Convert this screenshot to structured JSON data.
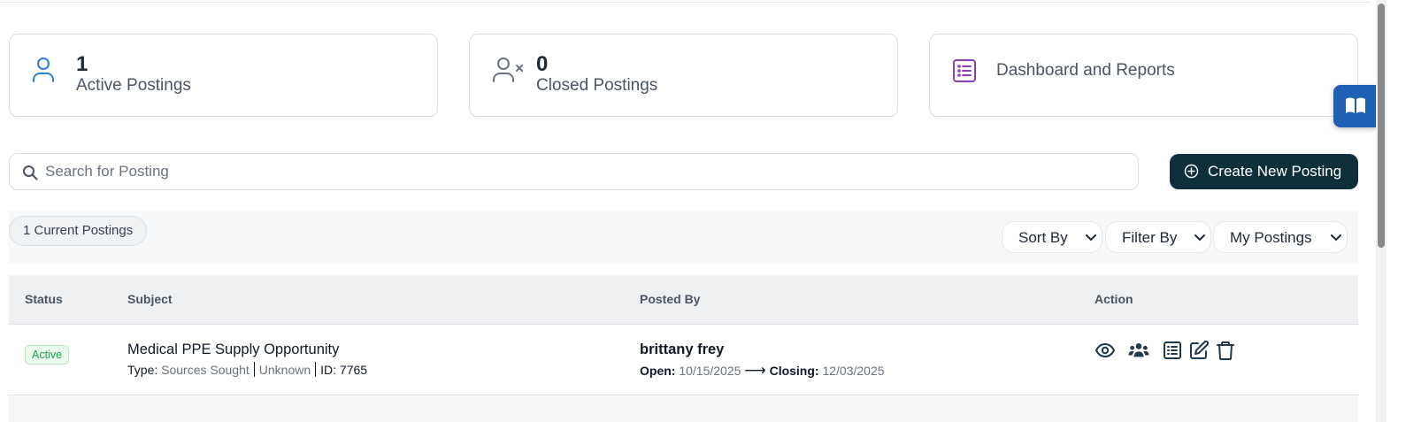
{
  "stats": {
    "active": {
      "count": "1",
      "label": "Active Postings",
      "icon": "user-icon",
      "color": "#2f7fd8"
    },
    "closed": {
      "count": "0",
      "label": "Closed Postings",
      "icon": "user-x-icon",
      "color": "#6b7280"
    },
    "reports": {
      "label": "Dashboard and Reports",
      "icon": "list-icon",
      "color": "#8e3fb8"
    }
  },
  "side_tab": {
    "icon": "book-icon",
    "color": "#1e60b3"
  },
  "search": {
    "placeholder": "Search for Posting"
  },
  "create_button": {
    "label": "Create New Posting",
    "icon": "plus-circle-icon",
    "color": "#0f2f3a"
  },
  "toolbar": {
    "count_label": "1 Current Postings",
    "sort_label": "Sort By",
    "filter_label": "Filter By",
    "owner_label": "My Postings"
  },
  "table": {
    "headers": {
      "status": "Status",
      "subject": "Subject",
      "posted_by": "Posted By",
      "action": "Action"
    },
    "rows": [
      {
        "status": "Active",
        "subject": "Medical PPE Supply Opportunity",
        "type_label": "Type:",
        "type_value": "Sources Sought",
        "category": "Unknown",
        "id_text": "ID: 7765",
        "poster": "brittany frey",
        "open_label": "Open:",
        "open_date": "10/15/2025",
        "arrow": "⟶",
        "closing_label": "Closing:",
        "closing_date": "12/03/2025",
        "actions": [
          "eye-icon",
          "users-icon",
          "list-icon",
          "edit-icon",
          "trash-icon"
        ]
      }
    ]
  }
}
